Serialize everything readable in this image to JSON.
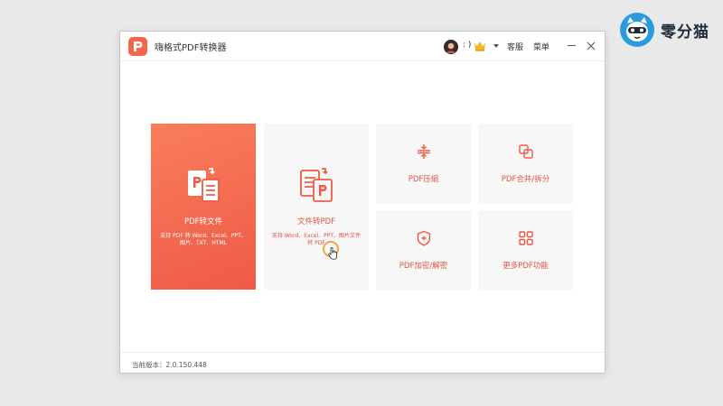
{
  "brand": {
    "name": "零分猫"
  },
  "window": {
    "title": "嗨格式PDF转换器",
    "user": {
      "name": ": )"
    },
    "service_label": "客服",
    "menu_label": "菜单"
  },
  "tiles": {
    "pdf_to_file": {
      "label": "PDF转文件",
      "subtitle": "支持 PDF 转 Word、Excel、PPT、图片、TXT、HTML"
    },
    "file_to_pdf": {
      "label": "文件转PDF",
      "subtitle": "支持 Word、Excel、PPT、图片文件转 PDF"
    },
    "compress": {
      "label": "PDF压缩"
    },
    "merge_split": {
      "label": "PDF合并/拆分"
    },
    "encrypt_decrypt": {
      "label": "PDF加密/解密"
    },
    "more": {
      "label": "更多PDF功能"
    }
  },
  "status": {
    "version": "当前版本：2.0.150.448"
  },
  "colors": {
    "accent": "#ef5a48",
    "tile_bg": "#f7f7f7"
  }
}
